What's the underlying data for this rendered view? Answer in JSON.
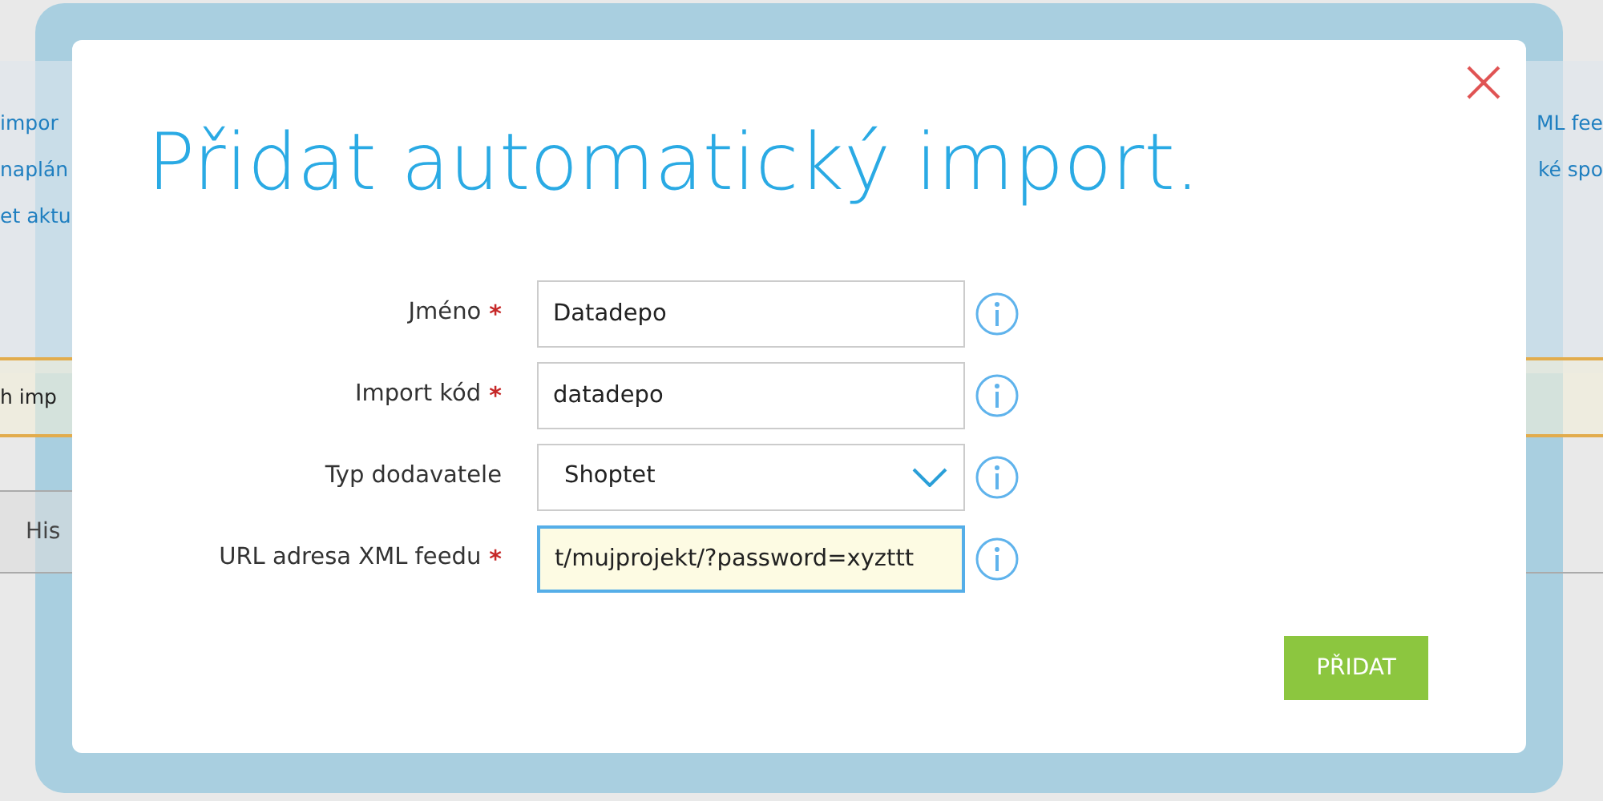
{
  "background": {
    "left_lines": [
      "impor",
      "naplán",
      "et aktu"
    ],
    "right_lines": [
      "ML fee",
      "ké spo"
    ],
    "warning": "h imp",
    "tab": "His"
  },
  "dialog": {
    "title": "Přidat automatický import.",
    "fields": [
      {
        "kind": "text",
        "label": "Jméno",
        "required_mark": "*",
        "value": "Datadepo",
        "focused": false
      },
      {
        "kind": "text",
        "label": "Import kód",
        "required_mark": "*",
        "value": "datadepo",
        "focused": false
      },
      {
        "kind": "select",
        "label": "Typ dodavatele",
        "value": "Shoptet",
        "focused": false
      },
      {
        "kind": "text",
        "label": "URL adresa XML feedu",
        "required_mark": "*",
        "value": "t/mujprojekt/?password=xyzttt",
        "focused": true
      }
    ],
    "submit": "PŘIDAT"
  }
}
